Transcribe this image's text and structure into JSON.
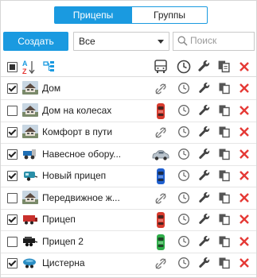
{
  "tabs": [
    {
      "label": "Прицепы",
      "active": true
    },
    {
      "label": "Группы",
      "active": false
    }
  ],
  "toolbar": {
    "create_label": "Создать",
    "filter_value": "Все",
    "search_placeholder": "Поиск"
  },
  "colors": {
    "accent": "#1a9ae0",
    "delete": "#e53935",
    "car_red": "#d83b2e",
    "car_green": "#2fae4a",
    "car_blue": "#1f5fcf",
    "car_silver": "#b9c3cc"
  },
  "header_icons": [
    "select-all-checkbox",
    "sort-az-icon",
    "hierarchy-icon",
    "vehicle-column-icon",
    "schedule-column-icon",
    "settings-column-icon",
    "copy-column-icon",
    "delete-column-icon"
  ],
  "rows": [
    {
      "name": "Дом",
      "checked": true,
      "thumb": "house",
      "binding": "link"
    },
    {
      "name": "Дом на колесах",
      "checked": false,
      "thumb": "house",
      "binding": "red-car"
    },
    {
      "name": "Комфорт в пути",
      "checked": true,
      "thumb": "house",
      "binding": "link"
    },
    {
      "name": "Навесное обору...",
      "checked": true,
      "thumb": "gear",
      "binding": "silver-car"
    },
    {
      "name": "Новый прицеп",
      "checked": true,
      "thumb": "trailer",
      "binding": "blue-car"
    },
    {
      "name": "Передвижное ж...",
      "checked": false,
      "thumb": "house",
      "binding": "link"
    },
    {
      "name": "Прицеп",
      "checked": true,
      "thumb": "red-truck",
      "binding": "red-car"
    },
    {
      "name": "Прицеп 2",
      "checked": false,
      "thumb": "black-trailer",
      "binding": "green-car"
    },
    {
      "name": "Цистерна",
      "checked": true,
      "thumb": "tank",
      "binding": "link"
    }
  ]
}
